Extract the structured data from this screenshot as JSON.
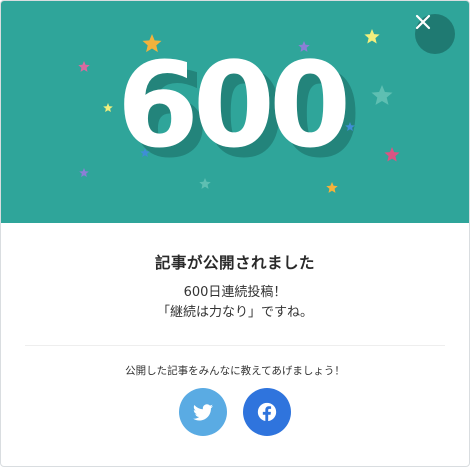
{
  "hero": {
    "background_color": "#2fa59a",
    "count": "600"
  },
  "close": {
    "icon": "close-icon"
  },
  "message": {
    "headline": "記事が公開されました",
    "line1": "600日連続投稿！",
    "line2": "「継続は力なり」ですね。"
  },
  "share": {
    "prompt": "公開した記事をみんなに教えてあげましょう！",
    "twitter_icon": "twitter-icon",
    "facebook_icon": "facebook-icon",
    "twitter_color": "#5aabe3",
    "facebook_color": "#2f74dd"
  }
}
